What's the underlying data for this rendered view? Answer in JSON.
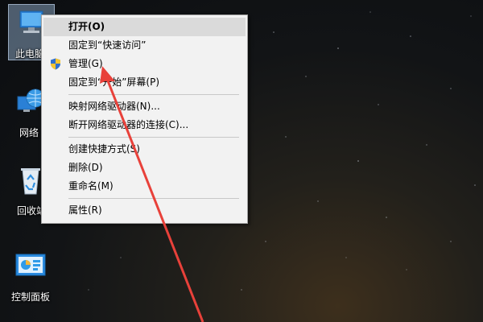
{
  "desktop": {
    "icons": [
      {
        "label": "此电脑"
      },
      {
        "label": "网络"
      },
      {
        "label": "回收站"
      },
      {
        "label": "控制面板"
      }
    ]
  },
  "context_menu": {
    "items": [
      {
        "label": "打开(O)"
      },
      {
        "label": "固定到“快速访问”"
      },
      {
        "label": "管理(G)",
        "icon": "uac-shield-icon"
      },
      {
        "label": "固定到“开始”屏幕(P)"
      },
      {
        "label": "映射网络驱动器(N)..."
      },
      {
        "label": "断开网络驱动器的连接(C)..."
      },
      {
        "label": "创建快捷方式(S)"
      },
      {
        "label": "删除(D)"
      },
      {
        "label": "重命名(M)"
      },
      {
        "label": "属性(R)"
      }
    ]
  },
  "colors": {
    "menu_bg": "#f2f2f2",
    "highlight": "#dadada",
    "arrow": "#e8413a",
    "selection": "#a0bee1"
  }
}
